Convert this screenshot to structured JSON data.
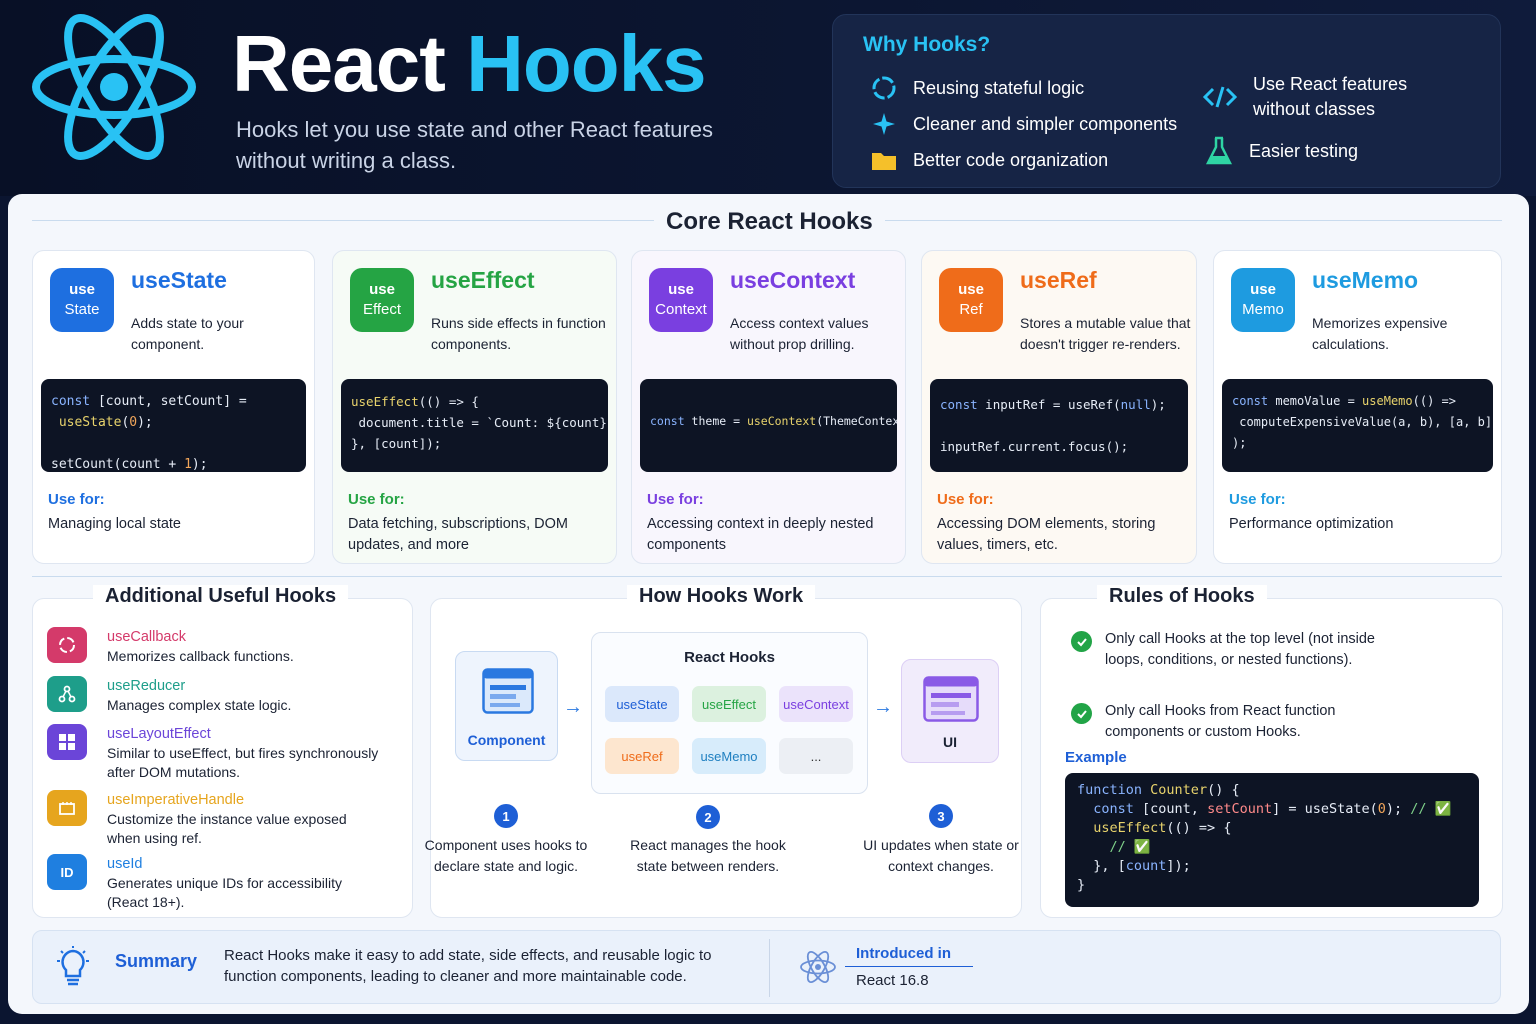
{
  "header": {
    "title_part1": "React",
    "title_part2": "Hooks",
    "subtitle": "Hooks let you use state and other React features without writing a class."
  },
  "why": {
    "title": "Why Hooks?",
    "items": [
      "Reusing stateful logic",
      "Cleaner and simpler components",
      "Better code organization",
      "Use React features without classes",
      "Easier testing"
    ]
  },
  "core": {
    "title": "Core React Hooks",
    "use_for_label": "Use for:",
    "cards": [
      {
        "badge1": "use",
        "badge2": "State",
        "name": "useState",
        "desc": "Adds state to your component.",
        "use": "Managing local state",
        "color": "#1e6fe0"
      },
      {
        "badge1": "use",
        "badge2": "Effect",
        "name": "useEffect",
        "desc": "Runs side effects in function components.",
        "use": "Data fetching, subscriptions, DOM updates, and more",
        "color": "#25a444"
      },
      {
        "badge1": "use",
        "badge2": "Context",
        "name": "useContext",
        "desc": "Access context values without prop drilling.",
        "use": "Accessing context in deeply nested components",
        "color": "#7a3fe0"
      },
      {
        "badge1": "use",
        "badge2": "Ref",
        "name": "useRef",
        "desc": "Stores a mutable value that doesn't trigger re-renders.",
        "use": "Accessing DOM elements, storing values, timers, etc.",
        "color": "#ef6c1a"
      },
      {
        "badge1": "use",
        "badge2": "Memo",
        "name": "useMemo",
        "desc": "Memorizes expensive calculations.",
        "use": "Performance optimization",
        "color": "#1e9be0"
      }
    ]
  },
  "additional": {
    "title": "Additional Useful Hooks",
    "items": [
      {
        "name": "useCallback",
        "desc": "Memorizes callback functions.",
        "color": "#d43a6a"
      },
      {
        "name": "useReducer",
        "desc": "Manages complex state logic.",
        "color": "#1e9e8a"
      },
      {
        "name": "useLayoutEffect",
        "desc": "Similar to useEffect, but fires synchronously after DOM mutations.",
        "color": "#6b45d8"
      },
      {
        "name": "useImperativeHandle",
        "desc": "Customize the instance value exposed when using ref.",
        "color": "#e6a51e"
      },
      {
        "name": "useId",
        "desc": "Generates unique IDs for accessibility (React 18+).",
        "color": "#1f7fe0",
        "icon": "ID"
      }
    ]
  },
  "how": {
    "title": "How Hooks Work",
    "component": "Component",
    "react_hooks": "React Hooks",
    "ui": "UI",
    "pills": [
      "useState",
      "useEffect",
      "useContext",
      "useRef",
      "useMemo",
      "..."
    ],
    "steps": [
      {
        "n": "1",
        "text": "Component uses hooks to declare state and logic."
      },
      {
        "n": "2",
        "text": "React manages the hook state between renders."
      },
      {
        "n": "3",
        "text": "UI updates when state or context changes."
      }
    ]
  },
  "rules": {
    "title": "Rules of Hooks",
    "items": [
      "Only call Hooks at the top level (not inside loops, conditions, or nested functions).",
      "Only call Hooks from React function components or custom Hooks."
    ],
    "example_label": "Example"
  },
  "summary": {
    "label": "Summary",
    "text": "React Hooks make it easy to add state, side effects, and reusable logic to function components, leading to cleaner and more maintainable code.",
    "intro_label": "Introduced in",
    "intro_value": "React 16.8"
  }
}
